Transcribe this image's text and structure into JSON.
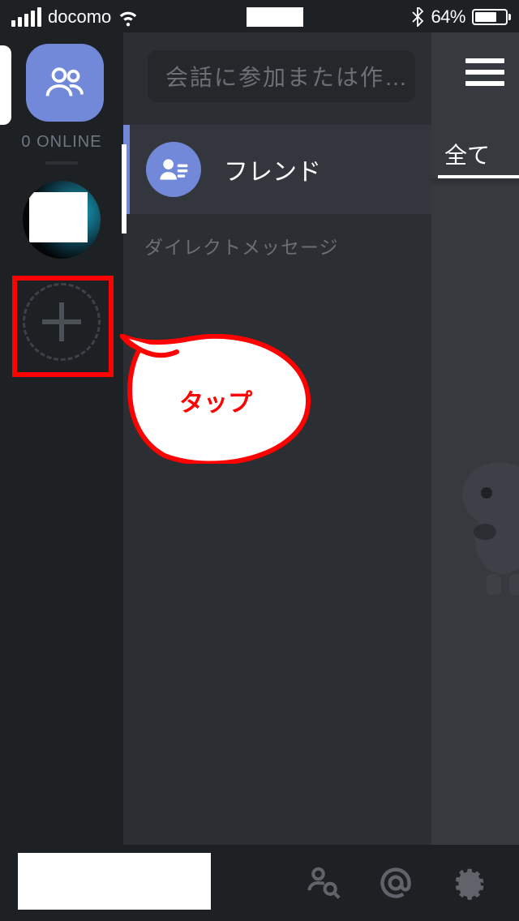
{
  "status": {
    "carrier": "docomo",
    "battery_pct": "64%"
  },
  "rail": {
    "online_label": "0 ONLINE"
  },
  "channels": {
    "search_placeholder": "会話に参加または作…",
    "friends_label": "フレンド",
    "dm_section_label": "ダイレクトメッセージ"
  },
  "right": {
    "tab_label": "全て"
  },
  "callout": {
    "text": "タップ"
  },
  "colors": {
    "accent": "#7289da",
    "highlight": "#fe0101"
  }
}
